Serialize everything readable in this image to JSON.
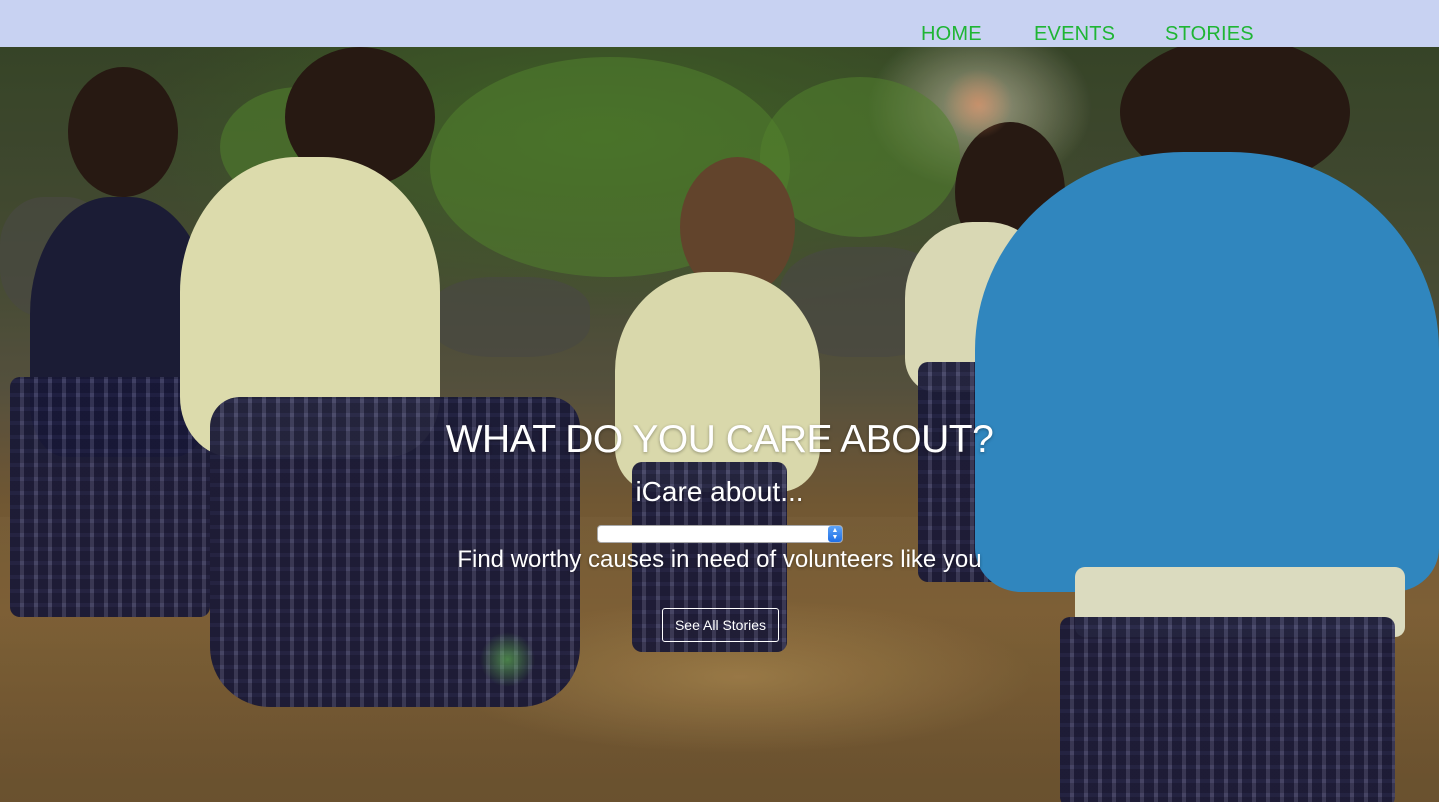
{
  "nav": {
    "items": [
      {
        "label": "HOME"
      },
      {
        "label": "EVENTS"
      },
      {
        "label": "STORIES"
      }
    ],
    "link_color": "#1fb534",
    "background_color": "#c8d2f2"
  },
  "hero": {
    "headline": "WHAT DO YOU CARE ABOUT?",
    "subheadline": "iCare about...",
    "select": {
      "selected_value": ""
    },
    "tagline": "Find worthy causes in need of volunteers like you",
    "button_label": "See All Stories"
  }
}
